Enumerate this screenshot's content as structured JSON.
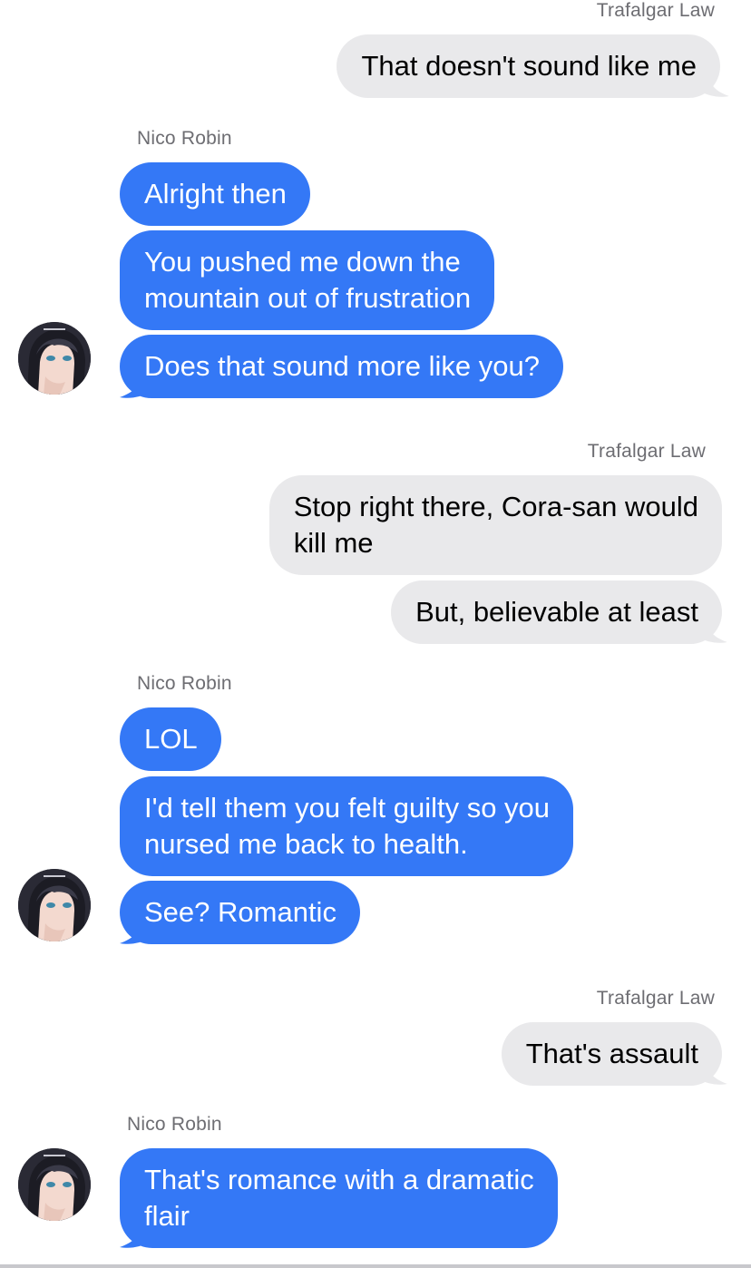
{
  "conversation": {
    "messages": [
      {
        "sender": "Trafalgar Law",
        "direction": "outgoing",
        "show_name": true,
        "text": "That doesn't sound like me"
      },
      {
        "sender": "Nico Robin",
        "direction": "incoming",
        "show_name": true,
        "text": "Alright then"
      },
      {
        "sender": "Nico Robin",
        "direction": "incoming",
        "show_name": false,
        "text": "You pushed me down the\nmountain out of frustration"
      },
      {
        "sender": "Nico Robin",
        "direction": "incoming",
        "show_name": false,
        "text": "Does that sound more like you?"
      },
      {
        "sender": "Trafalgar Law",
        "direction": "outgoing",
        "show_name": true,
        "text": "Stop right there, Cora-san would\nkill me"
      },
      {
        "sender": "Trafalgar Law",
        "direction": "outgoing",
        "show_name": false,
        "text": "But, believable at least"
      },
      {
        "sender": "Nico Robin",
        "direction": "incoming",
        "show_name": true,
        "text": "LOL"
      },
      {
        "sender": "Nico Robin",
        "direction": "incoming",
        "show_name": false,
        "text": "I'd tell them you felt guilty so you\nnursed me back to health."
      },
      {
        "sender": "Nico Robin",
        "direction": "incoming",
        "show_name": false,
        "text": "See? Romantic"
      },
      {
        "sender": "Trafalgar Law",
        "direction": "outgoing",
        "show_name": true,
        "text": "That's assault"
      },
      {
        "sender": "Nico Robin",
        "direction": "incoming",
        "show_name": true,
        "text": "That's romance with a dramatic\nflair"
      }
    ]
  },
  "colors": {
    "incoming_bubble": "#3478f6",
    "outgoing_bubble": "#e9e9eb",
    "incoming_text": "#ffffff",
    "outgoing_text": "#000000",
    "sender_name": "#6d6d72",
    "background": "#ffffff"
  },
  "icons": {
    "avatar": "avatar-icon"
  }
}
